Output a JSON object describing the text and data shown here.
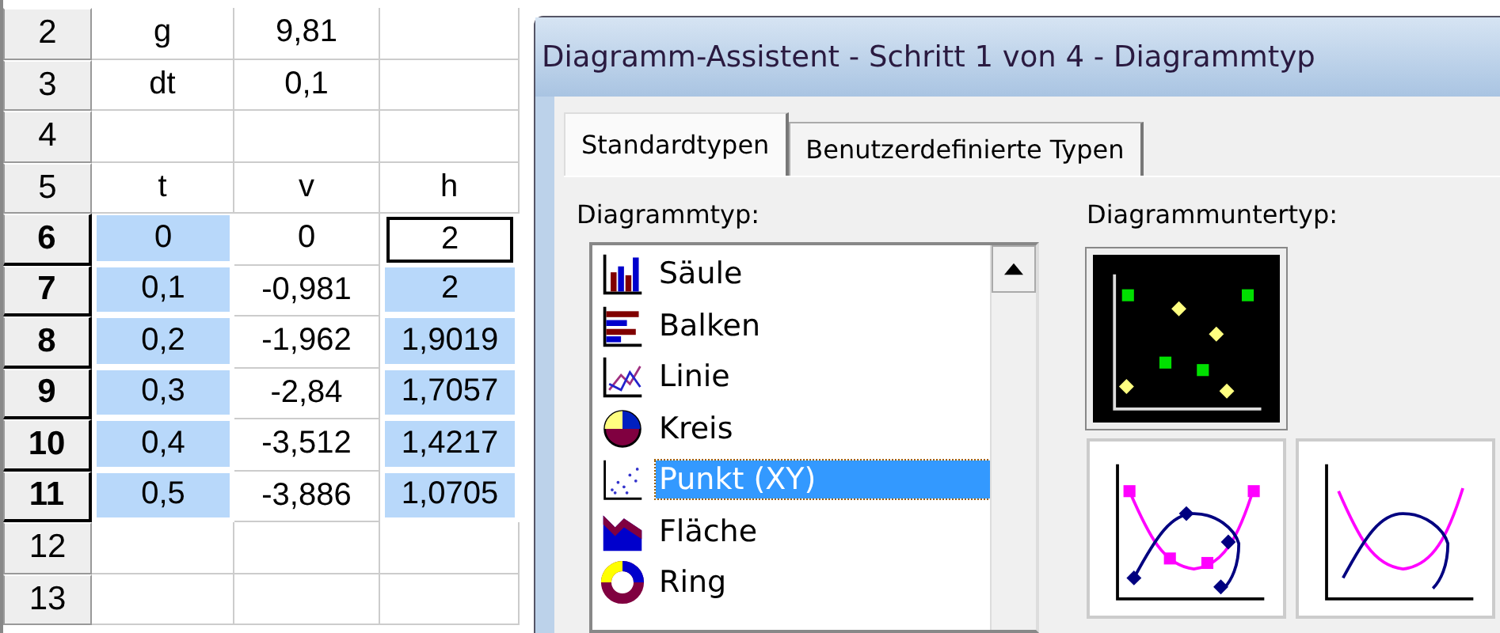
{
  "spreadsheet": {
    "rows": [
      {
        "header": "2",
        "selected": false,
        "cells": [
          {
            "text": "g",
            "selected": false,
            "active": false
          },
          {
            "text": "9,81",
            "selected": false,
            "active": false
          },
          {
            "selected": false,
            "active": false
          }
        ]
      },
      {
        "header": "3",
        "selected": false,
        "cells": [
          {
            "text": "dt",
            "selected": false,
            "active": false
          },
          {
            "text": "0,1",
            "selected": false,
            "active": false
          },
          {
            "selected": false,
            "active": false
          }
        ]
      },
      {
        "header": "4",
        "selected": false,
        "cells": [
          {
            "selected": false,
            "active": false
          },
          {
            "selected": false,
            "active": false
          },
          {
            "selected": false,
            "active": false
          }
        ]
      },
      {
        "header": "5",
        "selected": false,
        "cells": [
          {
            "text": "t",
            "selected": false,
            "active": false
          },
          {
            "text": "v",
            "selected": false,
            "active": false
          },
          {
            "text": "h",
            "selected": false,
            "active": false
          }
        ]
      },
      {
        "header": "6",
        "selected": true,
        "cells": [
          {
            "text": "0",
            "selected": true,
            "active": false
          },
          {
            "text": "0",
            "selected": false,
            "active": false
          },
          {
            "text": "2",
            "selected": false,
            "active": true
          }
        ]
      },
      {
        "header": "7",
        "selected": true,
        "cells": [
          {
            "text": "0,1",
            "selected": true,
            "active": false
          },
          {
            "text": "-0,981",
            "selected": false,
            "active": false
          },
          {
            "text": "2",
            "selected": true,
            "active": false
          }
        ]
      },
      {
        "header": "8",
        "selected": true,
        "cells": [
          {
            "text": "0,2",
            "selected": true,
            "active": false
          },
          {
            "text": "-1,962",
            "selected": false,
            "active": false
          },
          {
            "text": "1,9019",
            "selected": true,
            "active": false
          }
        ]
      },
      {
        "header": "9",
        "selected": true,
        "cells": [
          {
            "text": "0,3",
            "selected": true,
            "active": false
          },
          {
            "text": "-2,84",
            "selected": false,
            "active": false
          },
          {
            "text": "1,7057",
            "selected": true,
            "active": false
          }
        ]
      },
      {
        "header": "10",
        "selected": true,
        "cells": [
          {
            "text": "0,4",
            "selected": true,
            "active": false
          },
          {
            "text": "-3,512",
            "selected": false,
            "active": false
          },
          {
            "text": "1,4217",
            "selected": true,
            "active": false
          }
        ]
      },
      {
        "header": "11",
        "selected": true,
        "cells": [
          {
            "text": "0,5",
            "selected": true,
            "active": false
          },
          {
            "text": "-3,886",
            "selected": false,
            "active": false
          },
          {
            "text": "1,0705",
            "selected": true,
            "active": false
          }
        ]
      },
      {
        "header": "12",
        "selected": false,
        "cells": [
          {
            "selected": false,
            "active": false
          },
          {
            "selected": false,
            "active": false
          },
          {
            "selected": false,
            "active": false
          }
        ]
      },
      {
        "header": "13",
        "selected": false,
        "cells": [
          {
            "selected": false,
            "active": false
          },
          {
            "selected": false,
            "active": false
          },
          {
            "selected": false,
            "active": false
          }
        ]
      }
    ]
  },
  "dialog": {
    "title": "Diagramm-Assistent - Schritt 1 von 4 - Diagrammtyp",
    "tabs": [
      {
        "label": "Standardtypen",
        "selected": true
      },
      {
        "label": "Benutzerdefinierte Typen",
        "selected": false
      }
    ],
    "chart_type_label": "Diagrammtyp:",
    "chart_types": [
      {
        "label": "Säule",
        "kind": "column",
        "selected": false
      },
      {
        "label": "Balken",
        "kind": "bar",
        "selected": false
      },
      {
        "label": "Linie",
        "kind": "line",
        "selected": false
      },
      {
        "label": "Kreis",
        "kind": "pie",
        "selected": false
      },
      {
        "label": "Punkt (XY)",
        "kind": "scatter",
        "selected": true
      },
      {
        "label": "Fläche",
        "kind": "area",
        "selected": false
      },
      {
        "label": "Ring",
        "kind": "ring",
        "selected": false
      }
    ],
    "subtype_label": "Diagrammuntertyp:",
    "subtypes": [
      {
        "kind": "scatter",
        "selected": true
      },
      {
        "kind": "smooth-markers",
        "selected": false
      },
      {
        "kind": "smooth-lines",
        "selected": false
      }
    ]
  }
}
